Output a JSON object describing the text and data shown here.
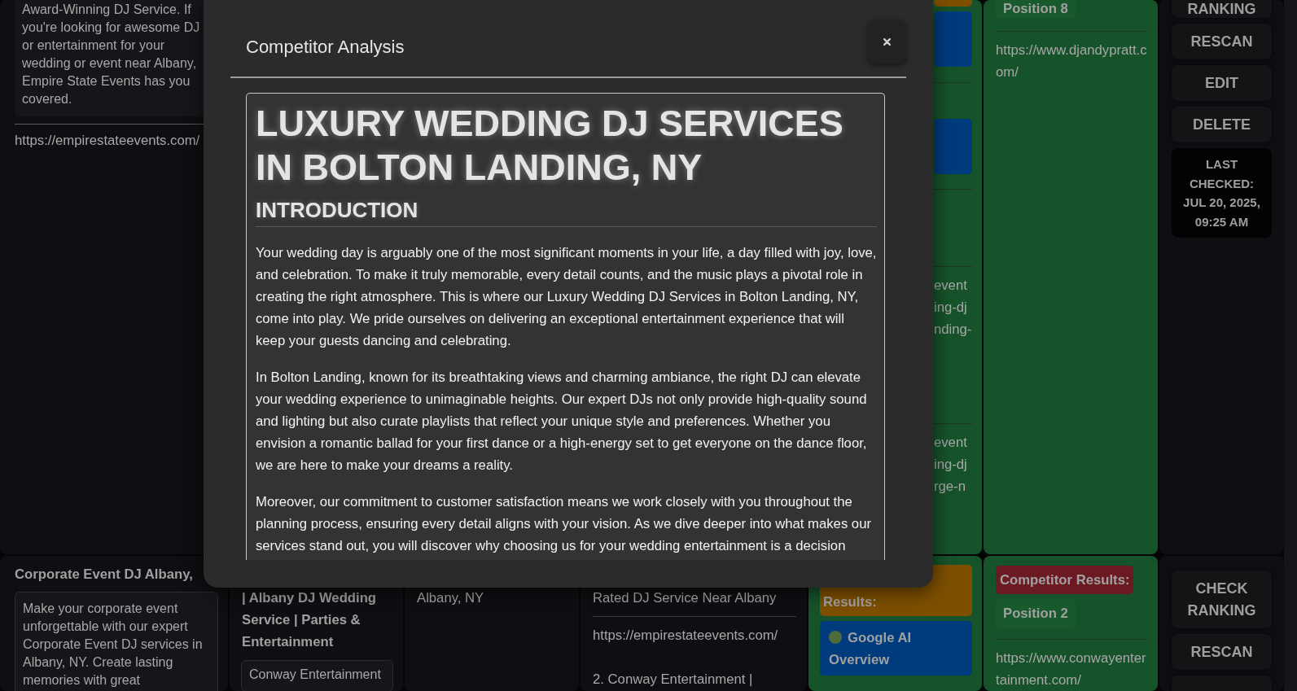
{
  "table": {
    "rows": [
      {
        "kind": "partial",
        "column_1": {
          "description": "Award-Winning DJ Service. If you're looking for awesome DJ or entertainment for your wedding or event near Albany, Empire State Events has you covered.",
          "url": "https://empirestateevents.com/"
        },
        "column_5": {
          "sections": [
            {
              "kind": "tags",
              "tags": [
                {
                  "kind": "cut",
                  "color": "#7d4f00"
                },
                {
                  "kind": "full",
                  "color": "#003b7e"
                }
              ]
            },
            {
              "kind": "tags",
              "tags": [
                {
                  "kind": "full",
                  "color": "#003b7e"
                }
              ]
            },
            {
              "kind": "blank"
            },
            {
              "kind": "text",
              "lines": [
                "event",
                "ing-dj",
                "nding-"
              ]
            },
            {
              "kind": "text",
              "lines": [
                "event",
                "ing-dj",
                "rge-n"
              ]
            }
          ]
        },
        "column_6": {
          "position": "Position 8",
          "url": "https://www.djandypratt.com/"
        },
        "column_7": {
          "buttons": [
            {
              "kind": "cut",
              "label": "RANKING"
            },
            {
              "kind": "full",
              "label": "RESCAN"
            },
            {
              "kind": "full",
              "label": "EDIT"
            },
            {
              "kind": "full",
              "label": "DELETE"
            }
          ],
          "last_checked": "LAST CHECKED: JUL 20, 2025, 09:25 AM"
        }
      },
      {
        "kind": "full",
        "column_1": {
          "title": "Corporate Event DJ Albany,",
          "description": "Make your corporate event unforgettable with our expert Corporate Event DJ services in Albany, NY. Create lasting memories with great"
        },
        "column_2": {
          "title": "| Albany DJ Wedding Service | Parties & Entertainment",
          "description": "Conway Entertainment"
        },
        "column_3": {
          "text": "Albany, NY"
        },
        "column_4": {
          "heading": "Rated DJ Service Near Albany",
          "lines": [
            "https://empirestateevents.com/",
            "2. Conway Entertainment |"
          ]
        },
        "column_5": {
          "sections": [
            {
              "kind": "tags",
              "tags": [
                {
                  "kind": "full",
                  "color": "#7d4f00",
                  "label": "Results:"
                },
                {
                  "kind": "full",
                  "color": "#003b7e",
                  "label": "Google AI Overview",
                  "dot": {
                    "color": "#4e6b3c"
                  }
                }
              ]
            }
          ]
        },
        "column_6": {
          "heading": "Competitor Results:",
          "position": "Position 2",
          "url": "https://www.conwayentertainment.com/"
        },
        "column_7": {
          "buttons": [
            {
              "kind": "full",
              "label": "CHECK RANKING"
            },
            {
              "kind": "full",
              "label": "RESCAN"
            },
            {
              "kind": "cut"
            }
          ]
        }
      }
    ]
  },
  "modal": {
    "title": "Competitor Analysis",
    "article": {
      "heading": "LUXURY WEDDING DJ SERVICES IN BOLTON LANDING, NY",
      "subheading": "INTRODUCTION",
      "paragraphs": [
        "Your wedding day is arguably one of the most significant moments in your life, a day filled with joy, love, and celebration. To make it truly memorable, every detail counts, and the music plays a pivotal role in creating the right atmosphere. This is where our Luxury Wedding DJ Services in Bolton Landing, NY, come into play. We pride ourselves on delivering an exceptional entertainment experience that will keep your guests dancing and celebrating.",
        "In Bolton Landing, known for its breathtaking views and charming ambiance, the right DJ can elevate your wedding experience to unimaginable heights. Our expert DJs not only provide high-quality sound and lighting but also curate playlists that reflect your unique style and preferences. Whether you envision a romantic ballad for your first dance or a high-energy set to get everyone on the dance floor, we are here to make your dreams a reality.",
        "Moreover, our commitment to customer satisfaction means we work closely with you throughout the planning process, ensuring every detail aligns with your vision. As we dive deeper into what makes our services stand out, you will discover why choosing us for your wedding entertainment is a decision"
      ]
    }
  }
}
